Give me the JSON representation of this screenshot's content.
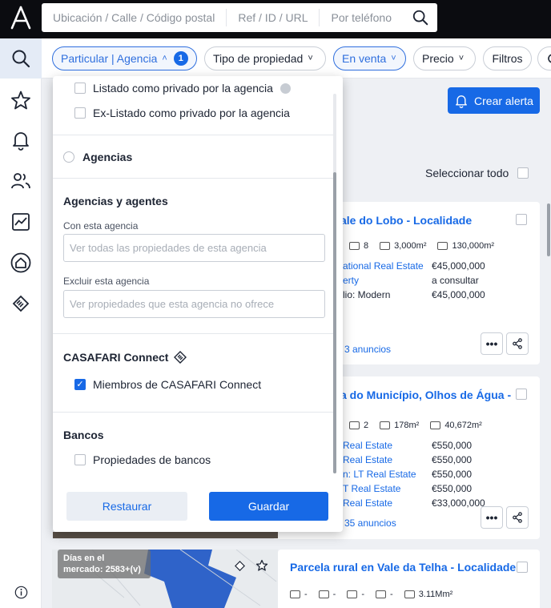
{
  "search": {
    "location_placeholder": "Ubicación / Calle / Código postal",
    "ref_placeholder": "Ref / ID / URL",
    "phone_placeholder": "Por teléfono"
  },
  "filters": {
    "particular": "Particular | Agencia",
    "particular_count": "1",
    "tipo": "Tipo de propiedad",
    "venta": "En venta",
    "precio": "Precio",
    "filtros": "Filtros"
  },
  "alert_button": "Crear alerta",
  "select_all": "Seleccionar todo",
  "dropdown": {
    "private_listing": "Listado como privado por la agencia",
    "ex_private": "Ex-Listado como privado por la agencia",
    "agencias": "Agencias",
    "agencias_agentes": "Agencias y agentes",
    "con_agencia_label": "Con esta agencia",
    "con_agencia_placeholder": "Ver todas las propiedades de esta agencia",
    "excluir_label": "Excluir esta agencia",
    "excluir_placeholder": "Ver propiedades que esta agencia no ofrece",
    "connect_title": "CASAFARI Connect",
    "connect_members": "Miembros de CASAFARI Connect",
    "bancos": "Bancos",
    "bancos_props": "Propiedades de bancos",
    "restaurar": "Restaurar",
    "guardar": "Guardar"
  },
  "card1": {
    "title": "ale do Lobo - Localidade",
    "beds": "8",
    "area": "3,000m²",
    "plot": "130,000m²",
    "rows": [
      {
        "left": "ational Real Estate",
        "right": "€45,000,000"
      },
      {
        "left": "erty",
        "right": "a consultar"
      },
      {
        "left": "lio: Modern",
        "right": "€45,000,000"
      }
    ],
    "anuncios": "3 anuncios"
  },
  "card2": {
    "title": "a do Município, Olhos de Água -",
    "beds": "2",
    "area": "178m²",
    "plot": "40,672m²",
    "rows": [
      {
        "left": "Real Estate",
        "right": "€550,000"
      },
      {
        "left": "Real Estate",
        "right": "€550,000"
      },
      {
        "left": "n: LT Real Estate",
        "right": "€550,000"
      },
      {
        "left": "T Real Estate",
        "right": "€550,000"
      },
      {
        "left": "Real Estate",
        "right": "€33,000,000"
      }
    ],
    "anuncios": "35 anuncios"
  },
  "card3": {
    "title": "Parcela rural en Vale da Telha - Localidade",
    "days": "Días en el mercado: 2583+(v)",
    "dash": "-",
    "plot": "3.11Mm²"
  }
}
